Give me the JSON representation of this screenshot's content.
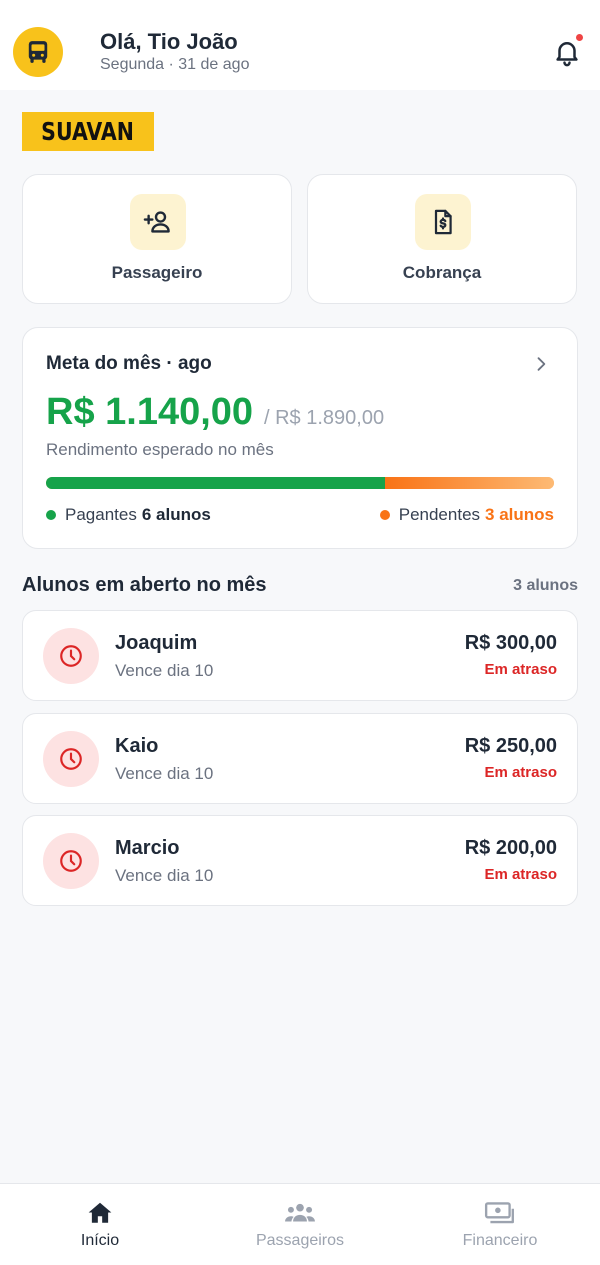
{
  "header": {
    "greeting": "Olá, Tio João",
    "date": "Segunda · 31 de ago",
    "has_notification": true
  },
  "brand": {
    "logo_text": "SUAVAN",
    "accent": "#f8c21b"
  },
  "actions": [
    {
      "label": "Passageiro",
      "icon": "add-person-icon"
    },
    {
      "label": "Cobrança",
      "icon": "invoice-icon"
    }
  ],
  "goal": {
    "title": "Meta do mês · ago",
    "amount": "R$ 1.140,00",
    "total": "/ R$ 1.890,00",
    "subtitle": "Rendimento esperado no mês",
    "paid_fraction": 0.667,
    "paid_label": "Pagantes",
    "paid_count": "6 alunos",
    "pending_label": "Pendentes",
    "pending_count": "3 alunos",
    "paid_color": "#16a34a",
    "pending_color": "#f97316"
  },
  "open_students": {
    "title": "Alunos em aberto no mês",
    "count": "3 alunos",
    "items": [
      {
        "name": "Joaquim",
        "due": "Vence dia 10",
        "amount": "R$ 300,00",
        "status": "Em atraso"
      },
      {
        "name": "Kaio",
        "due": "Vence dia 10",
        "amount": "R$ 250,00",
        "status": "Em atraso"
      },
      {
        "name": "Marcio",
        "due": "Vence dia 10",
        "amount": "R$ 200,00",
        "status": "Em atraso"
      }
    ]
  },
  "nav": {
    "items": [
      {
        "label": "Início",
        "icon": "home-icon",
        "active": true
      },
      {
        "label": "Passageiros",
        "icon": "users-icon",
        "active": false
      },
      {
        "label": "Financeiro",
        "icon": "money-icon",
        "active": false
      }
    ]
  }
}
